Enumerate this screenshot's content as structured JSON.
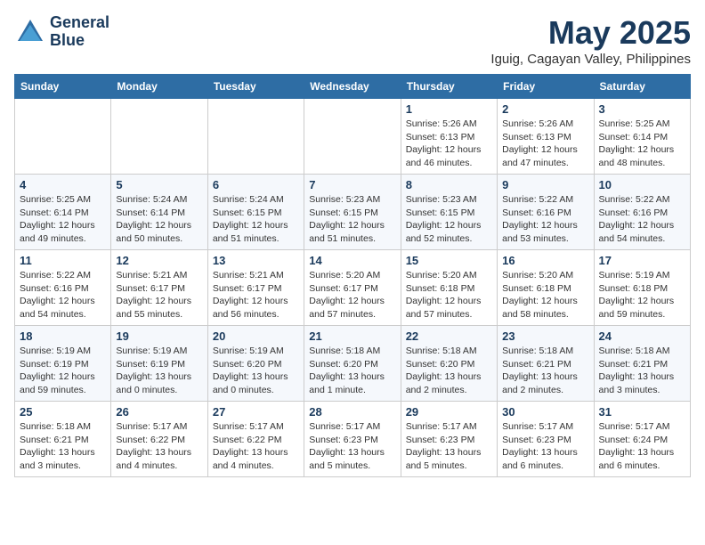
{
  "header": {
    "logo_line1": "General",
    "logo_line2": "Blue",
    "month": "May 2025",
    "location": "Iguig, Cagayan Valley, Philippines"
  },
  "weekdays": [
    "Sunday",
    "Monday",
    "Tuesday",
    "Wednesday",
    "Thursday",
    "Friday",
    "Saturday"
  ],
  "weeks": [
    [
      {
        "day": "",
        "info": ""
      },
      {
        "day": "",
        "info": ""
      },
      {
        "day": "",
        "info": ""
      },
      {
        "day": "",
        "info": ""
      },
      {
        "day": "1",
        "info": "Sunrise: 5:26 AM\nSunset: 6:13 PM\nDaylight: 12 hours\nand 46 minutes."
      },
      {
        "day": "2",
        "info": "Sunrise: 5:26 AM\nSunset: 6:13 PM\nDaylight: 12 hours\nand 47 minutes."
      },
      {
        "day": "3",
        "info": "Sunrise: 5:25 AM\nSunset: 6:14 PM\nDaylight: 12 hours\nand 48 minutes."
      }
    ],
    [
      {
        "day": "4",
        "info": "Sunrise: 5:25 AM\nSunset: 6:14 PM\nDaylight: 12 hours\nand 49 minutes."
      },
      {
        "day": "5",
        "info": "Sunrise: 5:24 AM\nSunset: 6:14 PM\nDaylight: 12 hours\nand 50 minutes."
      },
      {
        "day": "6",
        "info": "Sunrise: 5:24 AM\nSunset: 6:15 PM\nDaylight: 12 hours\nand 51 minutes."
      },
      {
        "day": "7",
        "info": "Sunrise: 5:23 AM\nSunset: 6:15 PM\nDaylight: 12 hours\nand 51 minutes."
      },
      {
        "day": "8",
        "info": "Sunrise: 5:23 AM\nSunset: 6:15 PM\nDaylight: 12 hours\nand 52 minutes."
      },
      {
        "day": "9",
        "info": "Sunrise: 5:22 AM\nSunset: 6:16 PM\nDaylight: 12 hours\nand 53 minutes."
      },
      {
        "day": "10",
        "info": "Sunrise: 5:22 AM\nSunset: 6:16 PM\nDaylight: 12 hours\nand 54 minutes."
      }
    ],
    [
      {
        "day": "11",
        "info": "Sunrise: 5:22 AM\nSunset: 6:16 PM\nDaylight: 12 hours\nand 54 minutes."
      },
      {
        "day": "12",
        "info": "Sunrise: 5:21 AM\nSunset: 6:17 PM\nDaylight: 12 hours\nand 55 minutes."
      },
      {
        "day": "13",
        "info": "Sunrise: 5:21 AM\nSunset: 6:17 PM\nDaylight: 12 hours\nand 56 minutes."
      },
      {
        "day": "14",
        "info": "Sunrise: 5:20 AM\nSunset: 6:17 PM\nDaylight: 12 hours\nand 57 minutes."
      },
      {
        "day": "15",
        "info": "Sunrise: 5:20 AM\nSunset: 6:18 PM\nDaylight: 12 hours\nand 57 minutes."
      },
      {
        "day": "16",
        "info": "Sunrise: 5:20 AM\nSunset: 6:18 PM\nDaylight: 12 hours\nand 58 minutes."
      },
      {
        "day": "17",
        "info": "Sunrise: 5:19 AM\nSunset: 6:18 PM\nDaylight: 12 hours\nand 59 minutes."
      }
    ],
    [
      {
        "day": "18",
        "info": "Sunrise: 5:19 AM\nSunset: 6:19 PM\nDaylight: 12 hours\nand 59 minutes."
      },
      {
        "day": "19",
        "info": "Sunrise: 5:19 AM\nSunset: 6:19 PM\nDaylight: 13 hours\nand 0 minutes."
      },
      {
        "day": "20",
        "info": "Sunrise: 5:19 AM\nSunset: 6:20 PM\nDaylight: 13 hours\nand 0 minutes."
      },
      {
        "day": "21",
        "info": "Sunrise: 5:18 AM\nSunset: 6:20 PM\nDaylight: 13 hours\nand 1 minute."
      },
      {
        "day": "22",
        "info": "Sunrise: 5:18 AM\nSunset: 6:20 PM\nDaylight: 13 hours\nand 2 minutes."
      },
      {
        "day": "23",
        "info": "Sunrise: 5:18 AM\nSunset: 6:21 PM\nDaylight: 13 hours\nand 2 minutes."
      },
      {
        "day": "24",
        "info": "Sunrise: 5:18 AM\nSunset: 6:21 PM\nDaylight: 13 hours\nand 3 minutes."
      }
    ],
    [
      {
        "day": "25",
        "info": "Sunrise: 5:18 AM\nSunset: 6:21 PM\nDaylight: 13 hours\nand 3 minutes."
      },
      {
        "day": "26",
        "info": "Sunrise: 5:17 AM\nSunset: 6:22 PM\nDaylight: 13 hours\nand 4 minutes."
      },
      {
        "day": "27",
        "info": "Sunrise: 5:17 AM\nSunset: 6:22 PM\nDaylight: 13 hours\nand 4 minutes."
      },
      {
        "day": "28",
        "info": "Sunrise: 5:17 AM\nSunset: 6:23 PM\nDaylight: 13 hours\nand 5 minutes."
      },
      {
        "day": "29",
        "info": "Sunrise: 5:17 AM\nSunset: 6:23 PM\nDaylight: 13 hours\nand 5 minutes."
      },
      {
        "day": "30",
        "info": "Sunrise: 5:17 AM\nSunset: 6:23 PM\nDaylight: 13 hours\nand 6 minutes."
      },
      {
        "day": "31",
        "info": "Sunrise: 5:17 AM\nSunset: 6:24 PM\nDaylight: 13 hours\nand 6 minutes."
      }
    ]
  ]
}
